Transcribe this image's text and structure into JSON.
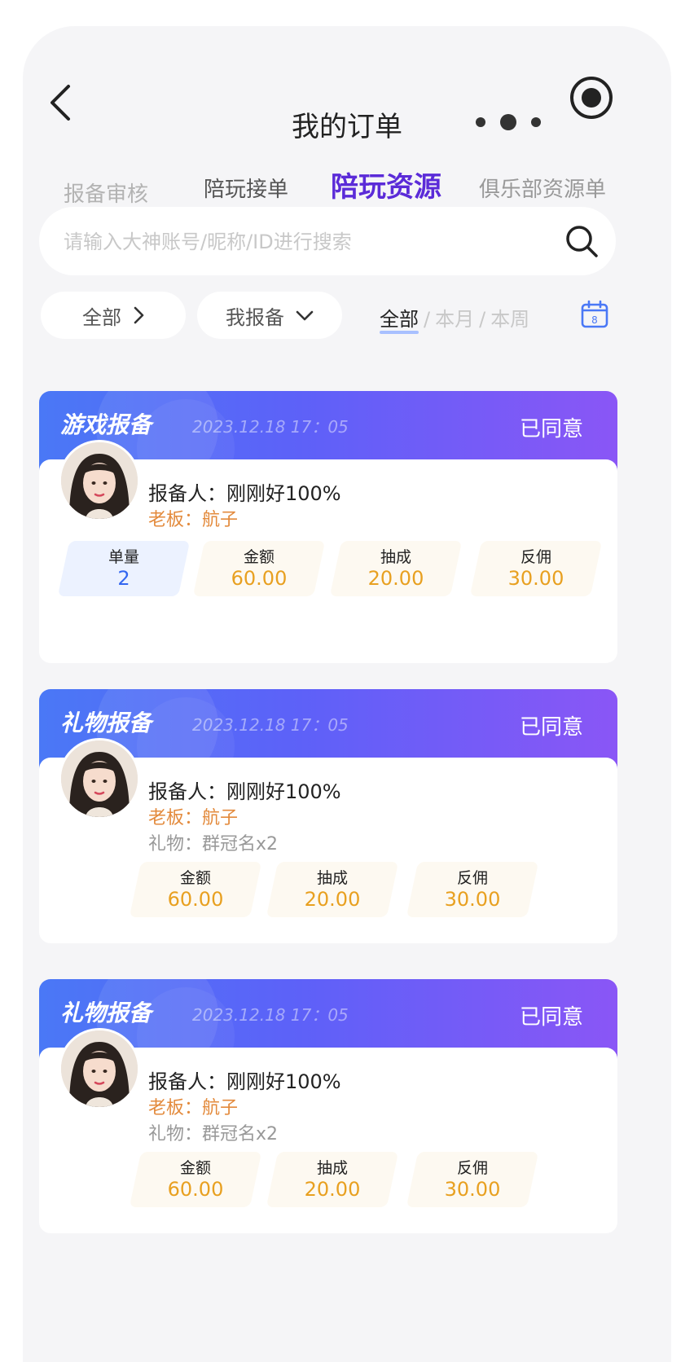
{
  "header": {
    "title": "我的订单"
  },
  "tabs": [
    {
      "label": "报备审核",
      "active": false
    },
    {
      "label": "陪玩接单",
      "active": false
    },
    {
      "label": "陪玩资源",
      "active": true
    },
    {
      "label": "俱乐部资源单",
      "active": false
    }
  ],
  "search": {
    "placeholder": "请输入大神账号/昵称/ID进行搜索",
    "value": ""
  },
  "filters": {
    "scope": "全部",
    "role": "我报备",
    "range": {
      "all": "全部",
      "month": "本月",
      "week": "本周",
      "separator": "/"
    },
    "calendar_day": "8"
  },
  "cards": [
    {
      "type": "游戏报备",
      "time": "2023.12.18 17：05",
      "status": "已同意",
      "reporter": "报备人：刚刚好100%",
      "boss": "老板：航子",
      "stats": [
        {
          "label": "单量",
          "value": "2"
        },
        {
          "label": "金额",
          "value": "60.00"
        },
        {
          "label": "抽成",
          "value": "20.00"
        },
        {
          "label": "反佣",
          "value": "30.00"
        }
      ]
    },
    {
      "type": "礼物报备",
      "time": "2023.12.18 17：05",
      "status": "已同意",
      "reporter": "报备人：刚刚好100%",
      "boss": "老板：航子",
      "gift": "礼物：群冠名x2",
      "stats": [
        {
          "label": "金额",
          "value": "60.00"
        },
        {
          "label": "抽成",
          "value": "20.00"
        },
        {
          "label": "反佣",
          "value": "30.00"
        }
      ]
    },
    {
      "type": "礼物报备",
      "time": "2023.12.18 17：05",
      "status": "已同意",
      "reporter": "报备人：刚刚好100%",
      "boss": "老板：航子",
      "gift": "礼物：群冠名x2",
      "stats": [
        {
          "label": "金额",
          "value": "60.00"
        },
        {
          "label": "抽成",
          "value": "20.00"
        },
        {
          "label": "反佣",
          "value": "30.00"
        }
      ]
    }
  ],
  "colors": {
    "accent": "#5b2bd8",
    "amount": "#e8a020",
    "boss": "#e38a3c",
    "count": "#3266f0"
  }
}
